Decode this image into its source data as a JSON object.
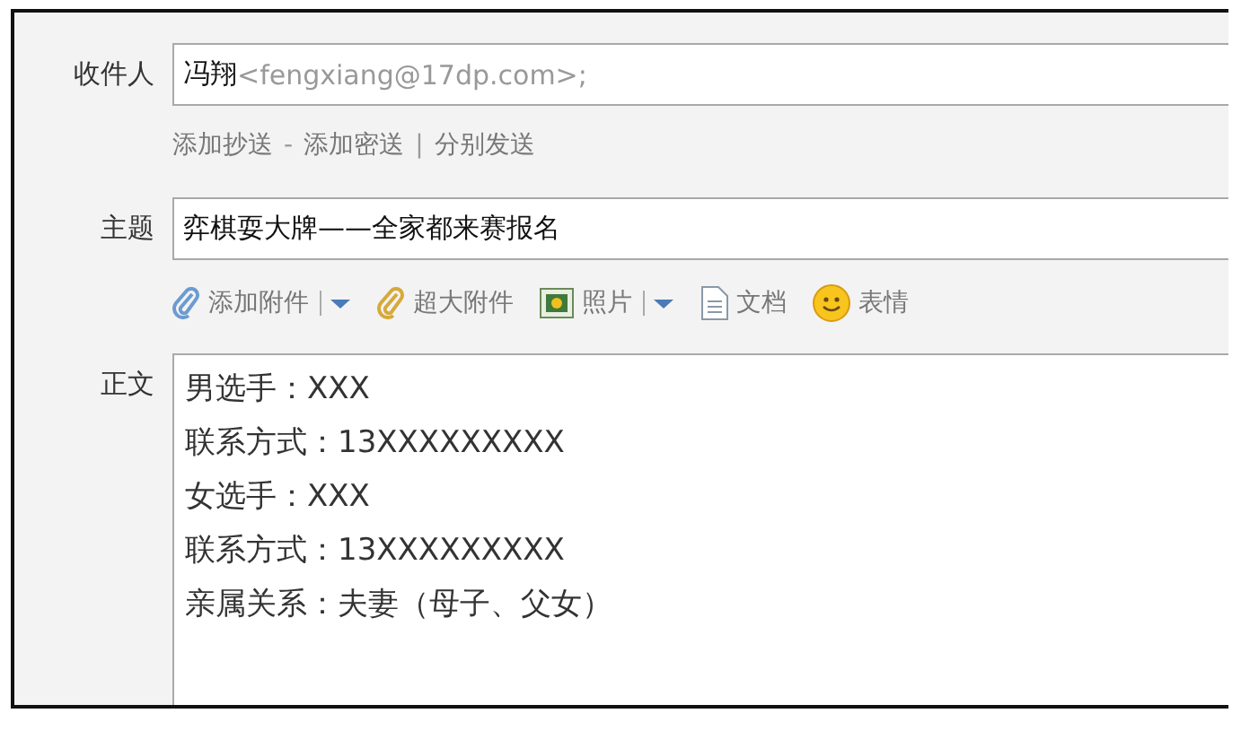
{
  "recipient": {
    "label": "收件人",
    "name": "冯翔",
    "address": "<fengxiang@17dp.com>;"
  },
  "cc_links": [
    {
      "kind": "link",
      "text": "添加抄送"
    },
    {
      "kind": "sep",
      "text": "-"
    },
    {
      "kind": "link",
      "text": "添加密送"
    },
    {
      "kind": "sep",
      "text": "|"
    },
    {
      "kind": "link",
      "text": "分别发送"
    }
  ],
  "subject": {
    "label": "主题",
    "value": "弈棋耍大牌——全家都来赛报名"
  },
  "toolbar": [
    {
      "kind": "clip",
      "label": "添加附件",
      "dropdown": true
    },
    {
      "kind": "bigclip",
      "label": "超大附件",
      "dropdown": false
    },
    {
      "kind": "photo",
      "label": "照片",
      "dropdown": true
    },
    {
      "kind": "doc",
      "label": "文档",
      "dropdown": false
    },
    {
      "kind": "emoji",
      "label": "表情",
      "dropdown": false
    }
  ],
  "body": {
    "label": "正文",
    "lines": [
      "男选手：XXX",
      "联系方式：13XXXXXXXXX",
      "女选手：XXX",
      "联系方式：13XXXXXXXXX",
      "亲属关系：夫妻（母子、父女）"
    ]
  }
}
